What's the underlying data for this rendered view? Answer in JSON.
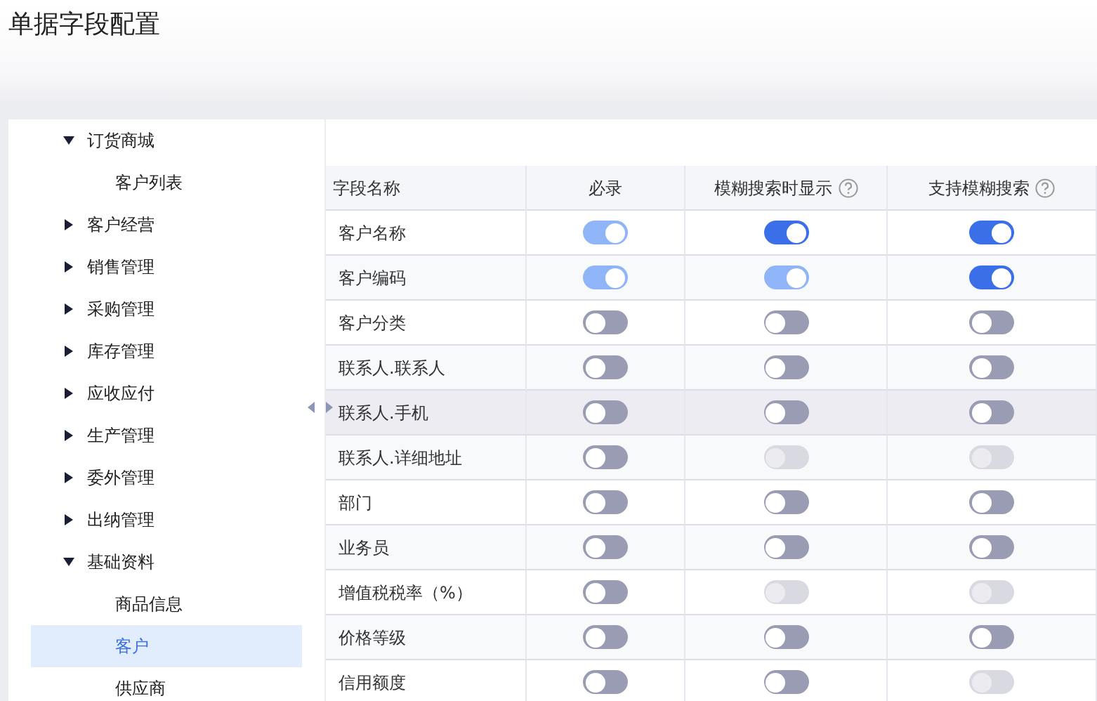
{
  "page_title": "单据字段配置",
  "sidebar": {
    "items": [
      {
        "label": "订货商城",
        "expanded": true,
        "children": [
          {
            "label": "客户列表",
            "selected": false
          }
        ]
      },
      {
        "label": "客户经营",
        "expanded": false
      },
      {
        "label": "销售管理",
        "expanded": false
      },
      {
        "label": "采购管理",
        "expanded": false
      },
      {
        "label": "库存管理",
        "expanded": false
      },
      {
        "label": "应收应付",
        "expanded": false
      },
      {
        "label": "生产管理",
        "expanded": false
      },
      {
        "label": "委外管理",
        "expanded": false
      },
      {
        "label": "出纳管理",
        "expanded": false
      },
      {
        "label": "基础资料",
        "expanded": true,
        "children": [
          {
            "label": "商品信息",
            "selected": false
          },
          {
            "label": "客户",
            "selected": true
          },
          {
            "label": "供应商",
            "selected": false
          }
        ]
      }
    ]
  },
  "table": {
    "columns": [
      {
        "label": "字段名称",
        "help": false
      },
      {
        "label": "必录",
        "help": false
      },
      {
        "label": "模糊搜索时显示",
        "help": true
      },
      {
        "label": "支持模糊搜索",
        "help": true
      }
    ],
    "rows": [
      {
        "name": "客户名称",
        "highlighted": false,
        "toggles": [
          {
            "on": true,
            "disabled": true
          },
          {
            "on": true,
            "disabled": false
          },
          {
            "on": true,
            "disabled": false
          }
        ]
      },
      {
        "name": "客户编码",
        "highlighted": false,
        "toggles": [
          {
            "on": true,
            "disabled": true
          },
          {
            "on": true,
            "disabled": true
          },
          {
            "on": true,
            "disabled": false
          }
        ]
      },
      {
        "name": "客户分类",
        "highlighted": false,
        "toggles": [
          {
            "on": false,
            "disabled": false
          },
          {
            "on": false,
            "disabled": false
          },
          {
            "on": false,
            "disabled": false
          }
        ]
      },
      {
        "name": "联系人.联系人",
        "highlighted": false,
        "toggles": [
          {
            "on": false,
            "disabled": false
          },
          {
            "on": false,
            "disabled": false
          },
          {
            "on": false,
            "disabled": false
          }
        ]
      },
      {
        "name": "联系人.手机",
        "highlighted": true,
        "toggles": [
          {
            "on": false,
            "disabled": false
          },
          {
            "on": false,
            "disabled": false
          },
          {
            "on": false,
            "disabled": false
          }
        ]
      },
      {
        "name": "联系人.详细地址",
        "highlighted": false,
        "toggles": [
          {
            "on": false,
            "disabled": false
          },
          {
            "on": false,
            "disabled": true
          },
          {
            "on": false,
            "disabled": true
          }
        ]
      },
      {
        "name": "部门",
        "highlighted": false,
        "toggles": [
          {
            "on": false,
            "disabled": false
          },
          {
            "on": false,
            "disabled": false
          },
          {
            "on": false,
            "disabled": false
          }
        ]
      },
      {
        "name": "业务员",
        "highlighted": false,
        "toggles": [
          {
            "on": false,
            "disabled": false
          },
          {
            "on": false,
            "disabled": false
          },
          {
            "on": false,
            "disabled": false
          }
        ]
      },
      {
        "name": "增值税税率（%）",
        "highlighted": false,
        "toggles": [
          {
            "on": false,
            "disabled": false
          },
          {
            "on": false,
            "disabled": true
          },
          {
            "on": false,
            "disabled": true
          }
        ]
      },
      {
        "name": "价格等级",
        "highlighted": false,
        "toggles": [
          {
            "on": false,
            "disabled": false
          },
          {
            "on": false,
            "disabled": false
          },
          {
            "on": false,
            "disabled": false
          }
        ]
      },
      {
        "name": "信用额度",
        "highlighted": false,
        "toggles": [
          {
            "on": false,
            "disabled": false
          },
          {
            "on": false,
            "disabled": false
          },
          {
            "on": false,
            "disabled": true
          }
        ]
      }
    ]
  }
}
